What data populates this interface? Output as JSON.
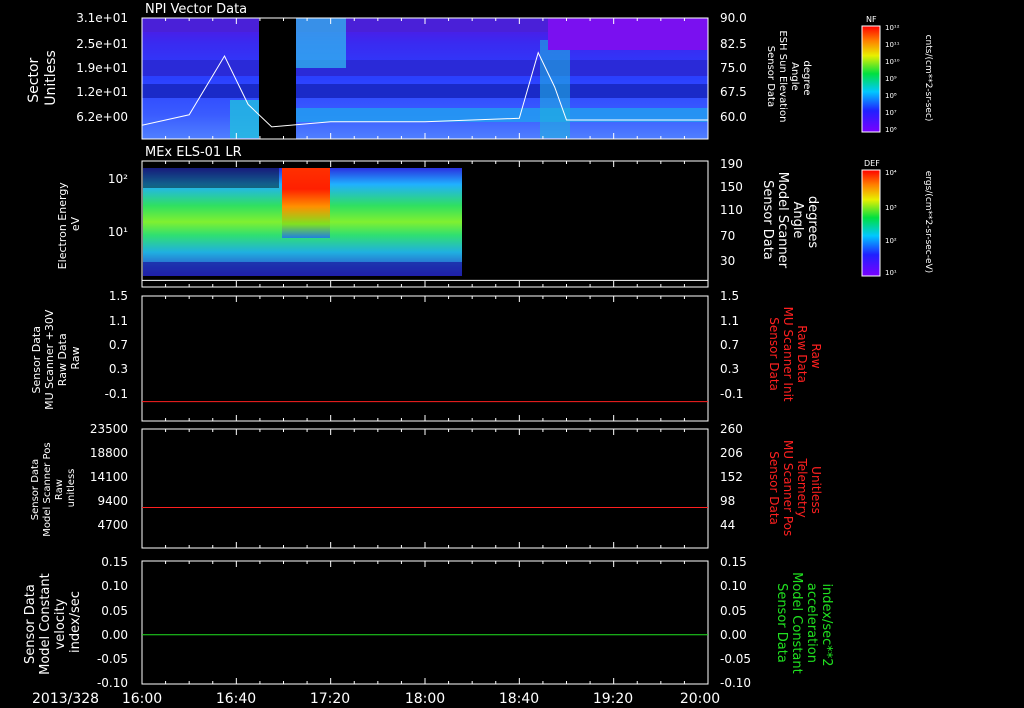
{
  "date_label": "2013/328",
  "x_ticks": [
    "16:00",
    "16:40",
    "17:20",
    "18:00",
    "18:40",
    "19:20",
    "20:00"
  ],
  "colors": {
    "red": "#ff2020",
    "green": "#20e020",
    "white": "#ffffff"
  },
  "colorbars": [
    {
      "title": "NF",
      "units": "cnts/(cm**2-sr-sec)",
      "ticks": [
        "10¹²",
        "10¹¹",
        "10¹⁰",
        "10⁹",
        "10⁸",
        "10⁷",
        "10⁶"
      ]
    },
    {
      "title": "DEF",
      "units": "ergs/(cm**2-sr-sec-eV)",
      "ticks": [
        "10⁴",
        "10³",
        "10²",
        "10¹"
      ]
    }
  ],
  "panels": [
    {
      "title": "NPI Vector Data",
      "left_label": [
        "Sector",
        "Unitless"
      ],
      "right_label": [
        "Sensor Data",
        "ESH Sun Elevation",
        "Angle",
        "degree"
      ],
      "left_ticks": [
        "3.1e+01",
        "2.5e+01",
        "1.9e+01",
        "1.2e+01",
        "6.2e+00"
      ],
      "right_ticks": [
        "90.0",
        "82.5",
        "75.0",
        "67.5",
        "60.0"
      ]
    },
    {
      "title": "MEx ELS-01 LR",
      "left_label": [
        "Electron Energy",
        "eV"
      ],
      "right_label": [
        "Sensor Data",
        "Model Scanner",
        "Angle",
        "degrees"
      ],
      "left_ticks": [
        "10²",
        "10¹"
      ],
      "right_ticks": [
        "190",
        "150",
        "110",
        "70",
        "30"
      ]
    },
    {
      "title": "",
      "left_label": [
        "Sensor Data",
        "MU Scanner +30V",
        "Raw Data",
        "Raw"
      ],
      "right_label": [
        "Sensor Data",
        "MU Scanner Init",
        "Raw Data",
        "Raw"
      ],
      "left_ticks": [
        "1.5",
        "1.1",
        "0.7",
        "0.3",
        "-0.1"
      ],
      "right_ticks": [
        "1.5",
        "1.1",
        "0.7",
        "0.3",
        "-0.1"
      ]
    },
    {
      "title": "",
      "left_label": [
        "Sensor Data",
        "Model Scanner Pos",
        "Raw",
        "unitless"
      ],
      "right_label": [
        "Sensor Data",
        "MU Scanner Pos",
        "Telemetry",
        "Unitless"
      ],
      "left_ticks": [
        "23500",
        "18800",
        "14100",
        "9400",
        "4700"
      ],
      "right_ticks": [
        "260",
        "206",
        "152",
        "98",
        "44"
      ]
    },
    {
      "title": "",
      "left_label": [
        "Sensor Data",
        "Model Constant",
        "velocity",
        "index/sec"
      ],
      "right_label": [
        "Sensor Data",
        "Model Constant",
        "acceleration",
        "index/sec**2"
      ],
      "left_ticks": [
        "0.15",
        "0.10",
        "0.05",
        "0.00",
        "-0.05",
        "-0.10"
      ],
      "right_ticks": [
        "0.15",
        "0.10",
        "0.05",
        "0.00",
        "-0.05",
        "-0.10"
      ]
    }
  ],
  "chart_data": [
    {
      "type": "heatmap",
      "title": "NPI Vector Data",
      "x_range": [
        "16:00",
        "20:00"
      ],
      "ylabel": "Sector Unitless",
      "ylim": [
        0,
        31
      ],
      "data_gaps": [
        [
          "16:45",
          "16:54"
        ]
      ],
      "overlay_series": {
        "name": "ESH Sun Elevation Angle",
        "ylim": [
          55,
          90
        ],
        "x": [
          "16:00",
          "16:20",
          "16:35",
          "16:45",
          "16:55",
          "17:20",
          "18:00",
          "18:40",
          "18:48",
          "18:55",
          "19:00",
          "20:00"
        ],
        "y": [
          59.0,
          62.0,
          79.0,
          65.0,
          58.5,
          60.0,
          60.0,
          61.0,
          80.0,
          70.0,
          60.5,
          60.5
        ]
      }
    },
    {
      "type": "heatmap",
      "title": "MEx ELS-01 LR",
      "x_range": [
        "16:00",
        "20:00"
      ],
      "data_x_range": [
        "16:00",
        "18:23"
      ],
      "ylabel": "Electron Energy eV",
      "y_scale": "log",
      "ylim": [
        1,
        200
      ],
      "enhancement_interval": [
        "17:00",
        "17:15"
      ],
      "overlay_series": {
        "name": "Model Scanner Angle",
        "ylim": [
          0,
          190
        ],
        "x": [
          "16:00",
          "20:00"
        ],
        "y": [
          10,
          10
        ]
      }
    },
    {
      "type": "line",
      "ylim": [
        -0.3,
        1.5
      ],
      "series": [
        {
          "name": "MU Scanner +30V Raw",
          "x": [
            "16:00",
            "20:00"
          ],
          "y": [
            -0.02,
            -0.02
          ]
        }
      ]
    },
    {
      "type": "line",
      "ylim": [
        0,
        23500
      ],
      "series": [
        {
          "name": "Model Scanner Pos Raw",
          "x": [
            "16:00",
            "20:00"
          ],
          "y": [
            8000,
            8000
          ]
        }
      ]
    },
    {
      "type": "line",
      "ylim": [
        -0.1,
        0.15
      ],
      "series": [
        {
          "name": "Model Constant velocity",
          "x": [
            "16:00",
            "20:00"
          ],
          "y": [
            0.0,
            0.0
          ]
        }
      ]
    }
  ]
}
